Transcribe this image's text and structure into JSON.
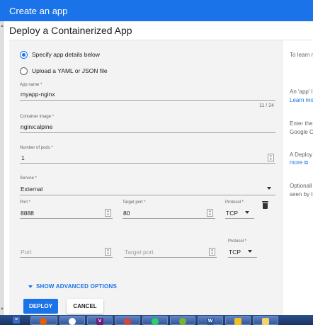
{
  "window": {
    "title": "Create an app"
  },
  "dialog": {
    "heading": "Deploy a Containerized App"
  },
  "mode": {
    "options": [
      "Specify app details below",
      "Upload a YAML or JSON file"
    ],
    "selected": "Specify app details below"
  },
  "app_name": {
    "label": "App name *",
    "value": "myapp-nginx",
    "counter": "11 / 24"
  },
  "container_image": {
    "label": "Container image *",
    "value": "nginx:alpine"
  },
  "pods": {
    "label": "Number of pods *",
    "value": "1"
  },
  "service": {
    "label": "Service *",
    "value": "External"
  },
  "ports": [
    {
      "port_label": "Port *",
      "port": "8888",
      "target_label": "Target port *",
      "target": "80",
      "protocol_label": "Protocol *",
      "protocol": "TCP"
    },
    {
      "port_placeholder": "Port",
      "target_placeholder": "Target port",
      "protocol_label": "Protocol *",
      "protocol": "TCP"
    }
  ],
  "advanced": {
    "label": "SHOW ADVANCED OPTIONS"
  },
  "buttons": {
    "deploy": "DEPLOY",
    "cancel": "CANCEL"
  },
  "side_help": {
    "line1": "To learn m",
    "line2": "An 'app' l",
    "line3": "Learn mo",
    "line4": "Enter the",
    "line5": "Google C",
    "line6": "A Deploy",
    "line7": "more",
    "line8": "Optionall",
    "line9": "seen by t"
  },
  "taskbar": {
    "icons": [
      "start-button",
      "firefox-icon",
      "network-icon",
      "vs-icon",
      "chrome-icon",
      "whatsapp-icon",
      "wechat-icon",
      "word-icon",
      "explorer-icon",
      "chart-app-icon"
    ],
    "labels": {
      "vs": "V",
      "word": "W"
    }
  },
  "colors": {
    "accent": "#1a73e8",
    "topbar": "#1a73e8",
    "panel": "#f3f3f3",
    "taskbar": "#1b3364"
  }
}
